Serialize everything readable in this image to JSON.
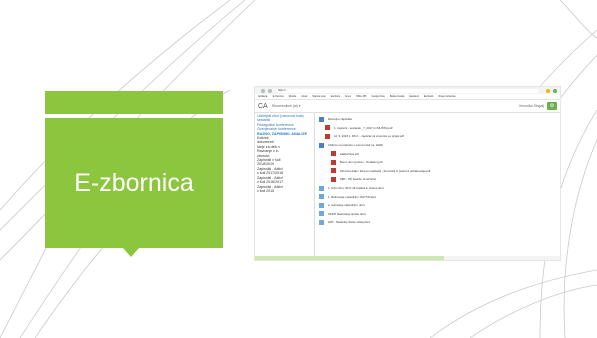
{
  "slide": {
    "title": "E-zbornica",
    "accent": "#8cc63f"
  },
  "screenshot": {
    "address": "https://...",
    "bookmarks": [
      "Aplikacije",
      "E-zbornica",
      "Moodle",
      "Gmail",
      "Spletna stran",
      "Eucilnica",
      "Arnes",
      "Office 365",
      "Google Drive",
      "Bralna znacka",
      "Easistent",
      "Eucbenik",
      "Druge zaznamke"
    ],
    "app": {
      "logo": "CA",
      "menu": "Stromieniłow (ai) ▾",
      "user": "Veronika Šingalj",
      "gear": "⚙"
    },
    "sidebar": {
      "items": [
        "Učiteljski zbor (osnovna šola)",
        "sestanki",
        "Pedagoške konference",
        "Ocenjevalne konference",
        "RAZNO, ZAPISNIKI, ANALIZE",
        "Kotiček",
        "dokumenti",
        "Ideje za delo v",
        "Ravnanje v e-",
        "zbornici",
        "Zapisniki v šoli",
        "2018/2019",
        "Zapisniki - Aktivi",
        "v šoli 2017/2018",
        "Zapisniki - Aktivi",
        "v šoli 2016/2017",
        "Zapisniki - Aktivi",
        "v šoli 2015"
      ]
    },
    "files": [
      {
        "type": "folder",
        "level": 0,
        "name": "Razvojne zapisnike"
      },
      {
        "type": "pdf",
        "level": 1,
        "name": "1. zapisnik - sestanek _7_2017 (ni MUŠTA).pdf"
      },
      {
        "type": "pdf",
        "level": 1,
        "name": "12. 9. 2018 1. RS 0. - zapisnik za smernice po prijavi.pdf"
      },
      {
        "type": "folder",
        "level": 0,
        "name": "Učilnice na prehodu v osnovni šoli (ur. 2020)"
      },
      {
        "type": "pdf",
        "level": 2,
        "name": "Zaključnica.pdf"
      },
      {
        "type": "pdf",
        "level": 2,
        "name": "Borov dom (prelom - Dodaten).pdf"
      },
      {
        "type": "pdf",
        "level": 2,
        "name": "Zbornica dalje / lista po realizaciji - Seminarji in poslovni pričakovanja.pdf"
      },
      {
        "type": "pdf",
        "level": 2,
        "name": "ZBP - OŠ (ksavfe; ki-tečnica)"
      },
      {
        "type": "doc",
        "level": 0,
        "name": "1. Srčni zbor, 2017-18 Analiza in pristop.docx"
      },
      {
        "type": "doc",
        "level": 0,
        "name": "1. Redovanje naslednjim 16177/8.docx"
      },
      {
        "type": "doc",
        "level": 0,
        "name": "2. redovanje naslednjim. docx"
      },
      {
        "type": "doc",
        "level": 0,
        "name": "SKRIT Redovanje spisan.docx"
      },
      {
        "type": "doc",
        "level": 0,
        "name": "LPR - Naslednji zbirke učitelj.docx"
      }
    ],
    "progress_fraction": 0.62
  }
}
